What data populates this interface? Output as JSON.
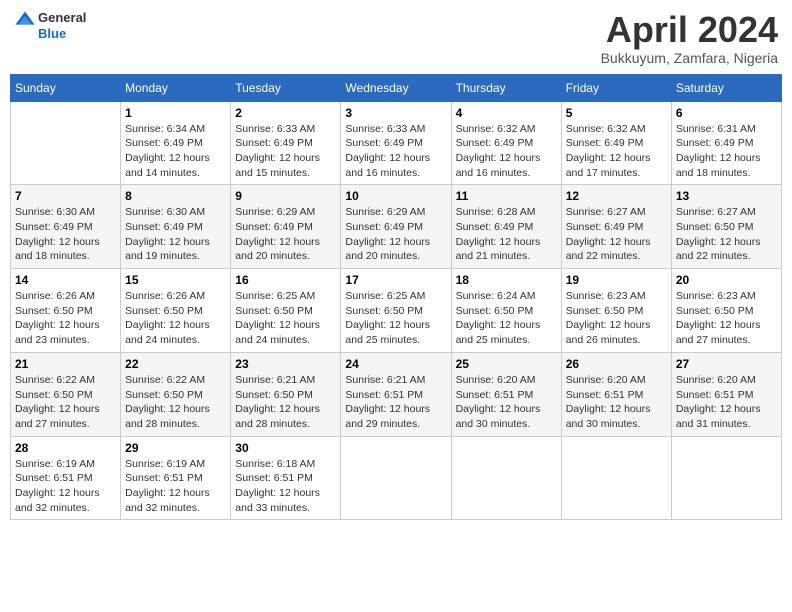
{
  "header": {
    "logo_general": "General",
    "logo_blue": "Blue",
    "month_title": "April 2024",
    "location": "Bukkuyum, Zamfara, Nigeria"
  },
  "days_of_week": [
    "Sunday",
    "Monday",
    "Tuesday",
    "Wednesday",
    "Thursday",
    "Friday",
    "Saturday"
  ],
  "weeks": [
    [
      {
        "day": "",
        "info": ""
      },
      {
        "day": "1",
        "info": "Sunrise: 6:34 AM\nSunset: 6:49 PM\nDaylight: 12 hours\nand 14 minutes."
      },
      {
        "day": "2",
        "info": "Sunrise: 6:33 AM\nSunset: 6:49 PM\nDaylight: 12 hours\nand 15 minutes."
      },
      {
        "day": "3",
        "info": "Sunrise: 6:33 AM\nSunset: 6:49 PM\nDaylight: 12 hours\nand 16 minutes."
      },
      {
        "day": "4",
        "info": "Sunrise: 6:32 AM\nSunset: 6:49 PM\nDaylight: 12 hours\nand 16 minutes."
      },
      {
        "day": "5",
        "info": "Sunrise: 6:32 AM\nSunset: 6:49 PM\nDaylight: 12 hours\nand 17 minutes."
      },
      {
        "day": "6",
        "info": "Sunrise: 6:31 AM\nSunset: 6:49 PM\nDaylight: 12 hours\nand 18 minutes."
      }
    ],
    [
      {
        "day": "7",
        "info": "Sunrise: 6:30 AM\nSunset: 6:49 PM\nDaylight: 12 hours\nand 18 minutes."
      },
      {
        "day": "8",
        "info": "Sunrise: 6:30 AM\nSunset: 6:49 PM\nDaylight: 12 hours\nand 19 minutes."
      },
      {
        "day": "9",
        "info": "Sunrise: 6:29 AM\nSunset: 6:49 PM\nDaylight: 12 hours\nand 20 minutes."
      },
      {
        "day": "10",
        "info": "Sunrise: 6:29 AM\nSunset: 6:49 PM\nDaylight: 12 hours\nand 20 minutes."
      },
      {
        "day": "11",
        "info": "Sunrise: 6:28 AM\nSunset: 6:49 PM\nDaylight: 12 hours\nand 21 minutes."
      },
      {
        "day": "12",
        "info": "Sunrise: 6:27 AM\nSunset: 6:49 PM\nDaylight: 12 hours\nand 22 minutes."
      },
      {
        "day": "13",
        "info": "Sunrise: 6:27 AM\nSunset: 6:50 PM\nDaylight: 12 hours\nand 22 minutes."
      }
    ],
    [
      {
        "day": "14",
        "info": "Sunrise: 6:26 AM\nSunset: 6:50 PM\nDaylight: 12 hours\nand 23 minutes."
      },
      {
        "day": "15",
        "info": "Sunrise: 6:26 AM\nSunset: 6:50 PM\nDaylight: 12 hours\nand 24 minutes."
      },
      {
        "day": "16",
        "info": "Sunrise: 6:25 AM\nSunset: 6:50 PM\nDaylight: 12 hours\nand 24 minutes."
      },
      {
        "day": "17",
        "info": "Sunrise: 6:25 AM\nSunset: 6:50 PM\nDaylight: 12 hours\nand 25 minutes."
      },
      {
        "day": "18",
        "info": "Sunrise: 6:24 AM\nSunset: 6:50 PM\nDaylight: 12 hours\nand 25 minutes."
      },
      {
        "day": "19",
        "info": "Sunrise: 6:23 AM\nSunset: 6:50 PM\nDaylight: 12 hours\nand 26 minutes."
      },
      {
        "day": "20",
        "info": "Sunrise: 6:23 AM\nSunset: 6:50 PM\nDaylight: 12 hours\nand 27 minutes."
      }
    ],
    [
      {
        "day": "21",
        "info": "Sunrise: 6:22 AM\nSunset: 6:50 PM\nDaylight: 12 hours\nand 27 minutes."
      },
      {
        "day": "22",
        "info": "Sunrise: 6:22 AM\nSunset: 6:50 PM\nDaylight: 12 hours\nand 28 minutes."
      },
      {
        "day": "23",
        "info": "Sunrise: 6:21 AM\nSunset: 6:50 PM\nDaylight: 12 hours\nand 28 minutes."
      },
      {
        "day": "24",
        "info": "Sunrise: 6:21 AM\nSunset: 6:51 PM\nDaylight: 12 hours\nand 29 minutes."
      },
      {
        "day": "25",
        "info": "Sunrise: 6:20 AM\nSunset: 6:51 PM\nDaylight: 12 hours\nand 30 minutes."
      },
      {
        "day": "26",
        "info": "Sunrise: 6:20 AM\nSunset: 6:51 PM\nDaylight: 12 hours\nand 30 minutes."
      },
      {
        "day": "27",
        "info": "Sunrise: 6:20 AM\nSunset: 6:51 PM\nDaylight: 12 hours\nand 31 minutes."
      }
    ],
    [
      {
        "day": "28",
        "info": "Sunrise: 6:19 AM\nSunset: 6:51 PM\nDaylight: 12 hours\nand 32 minutes."
      },
      {
        "day": "29",
        "info": "Sunrise: 6:19 AM\nSunset: 6:51 PM\nDaylight: 12 hours\nand 32 minutes."
      },
      {
        "day": "30",
        "info": "Sunrise: 6:18 AM\nSunset: 6:51 PM\nDaylight: 12 hours\nand 33 minutes."
      },
      {
        "day": "",
        "info": ""
      },
      {
        "day": "",
        "info": ""
      },
      {
        "day": "",
        "info": ""
      },
      {
        "day": "",
        "info": ""
      }
    ]
  ]
}
